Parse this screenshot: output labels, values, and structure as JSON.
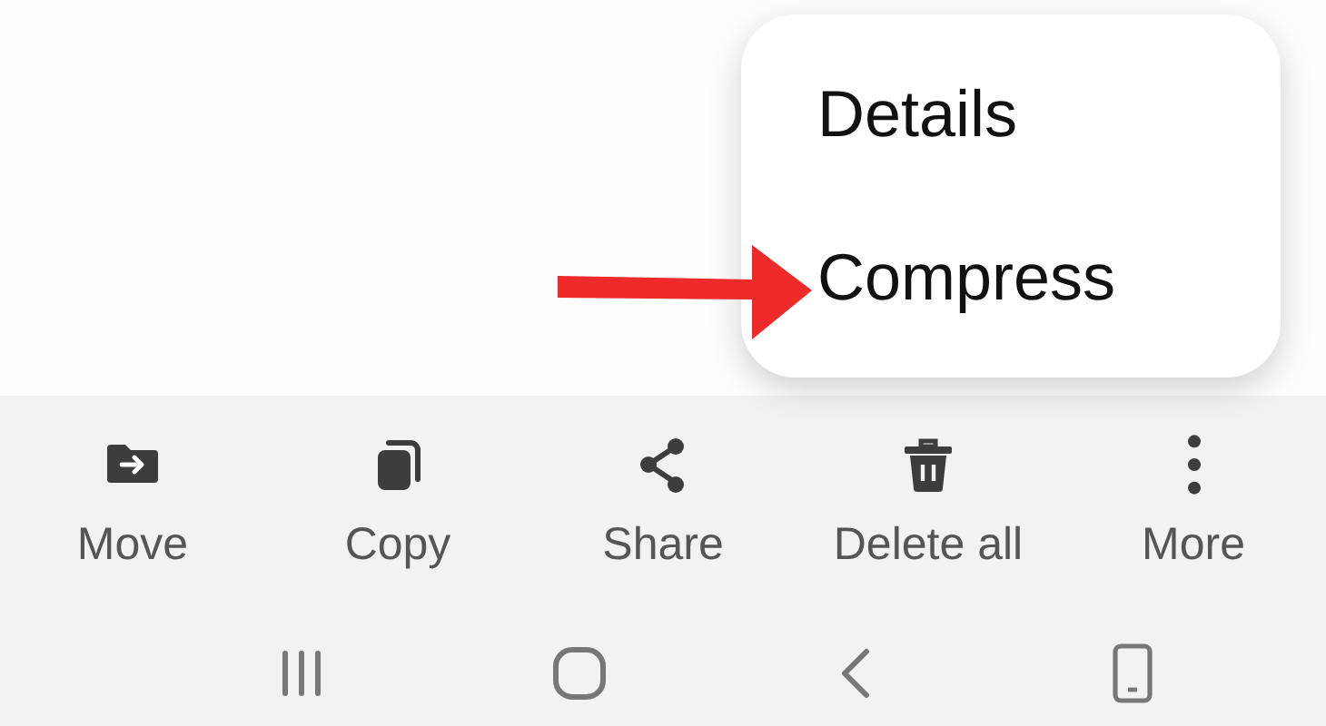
{
  "menu": {
    "items": [
      {
        "label": "Details"
      },
      {
        "label": "Compress"
      }
    ]
  },
  "toolbar": {
    "items": [
      {
        "label": "Move"
      },
      {
        "label": "Copy"
      },
      {
        "label": "Share"
      },
      {
        "label": "Delete all"
      },
      {
        "label": "More"
      }
    ]
  }
}
